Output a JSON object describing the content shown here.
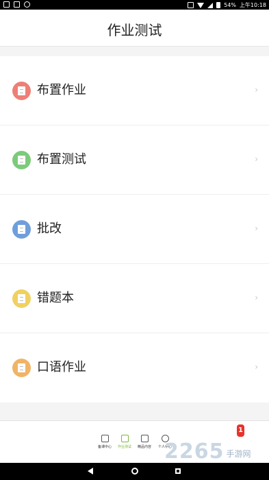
{
  "status_bar": {
    "battery": "54%",
    "time": "上午10:18"
  },
  "header": {
    "title": "作业测试"
  },
  "menu": [
    {
      "label": "布置作业",
      "icon": "assign-homework-icon",
      "color": "#ee7f77"
    },
    {
      "label": "布置测试",
      "icon": "assign-test-icon",
      "color": "#7ccb7b"
    },
    {
      "label": "批改",
      "icon": "grading-icon",
      "color": "#6f9fdb"
    },
    {
      "label": "错题本",
      "icon": "mistake-book-icon",
      "color": "#f0d160"
    },
    {
      "label": "口语作业",
      "icon": "oral-homework-icon",
      "color": "#f1b466"
    }
  ],
  "chevron": "›",
  "tabbar": {
    "tabs": [
      {
        "label": "备课中心"
      },
      {
        "label": "作业测试"
      },
      {
        "label": "精品内容"
      },
      {
        "label": "个人中心"
      }
    ],
    "active_color": "#7ab83c",
    "badge": "1"
  },
  "watermark": {
    "number": "2265",
    "text": "手游网"
  }
}
